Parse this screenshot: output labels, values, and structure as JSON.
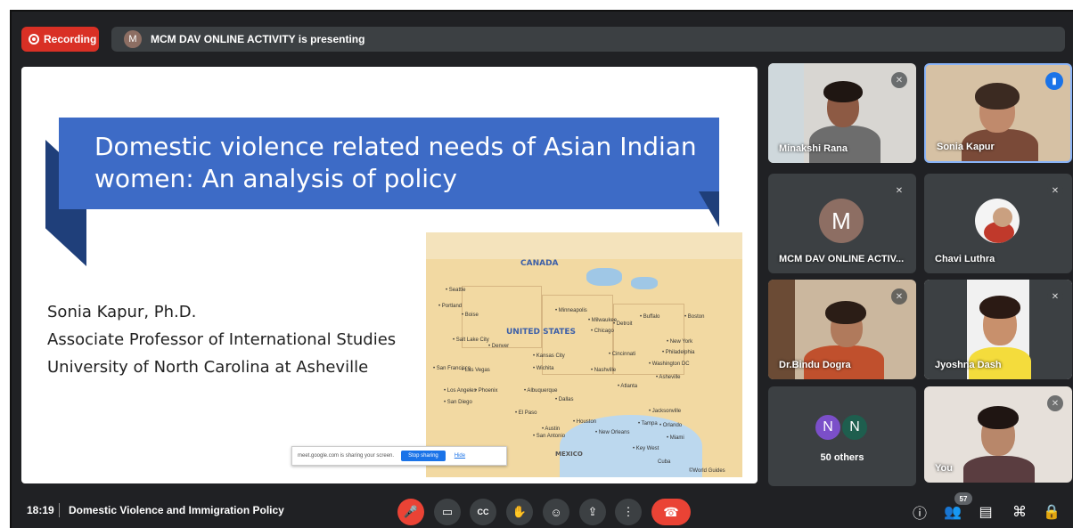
{
  "recording": {
    "label": "Recording"
  },
  "presenter_bar": {
    "avatar": "M",
    "text": "MCM DAV ONLINE ACTIVITY is presenting"
  },
  "slide": {
    "title": "Domestic violence related needs of Asian Indian women: An analysis of policy",
    "author_lines": [
      "Sonia Kapur, Ph.D.",
      "Associate Professor of International Studies",
      "University of North Carolina at Asheville"
    ],
    "map_labels": {
      "canada": "CANADA",
      "usa": "UNITED STATES",
      "mexico": "MEXICO",
      "cuba": "Cuba",
      "credit": "©World Guides"
    },
    "cities": [
      "Seattle",
      "Portland",
      "Boise",
      "Minneapolis",
      "Milwaukee",
      "Detroit",
      "Buffalo",
      "Boston",
      "Salt Lake City",
      "Denver",
      "Chicago",
      "Kansas City",
      "Cincinnati",
      "New York",
      "Philadelphia",
      "San Francisco",
      "Las Vegas",
      "Wichita",
      "Nashville",
      "Washington DC",
      "Los Angeles",
      "Phoenix",
      "Albuquerque",
      "Asheville",
      "Atlanta",
      "San Diego",
      "Dallas",
      "El Paso",
      "Houston",
      "Austin",
      "San Antonio",
      "New Orleans",
      "Jacksonville",
      "Tampa",
      "Orlando",
      "Miami",
      "Key West"
    ],
    "share_bar": {
      "text": "meet.google.com is sharing your screen.",
      "stop": "Stop sharing",
      "hide": "Hide"
    }
  },
  "participants": [
    {
      "name": "Minakshi Rana",
      "muted": true
    },
    {
      "name": "Sonia Kapur",
      "speaking": true
    },
    {
      "name": "MCM DAV ONLINE ACTIV...",
      "avatar": "M",
      "muted": true
    },
    {
      "name": "Chavi Luthra",
      "muted": true
    },
    {
      "name": "Dr.Bindu Dogra",
      "muted": true
    },
    {
      "name": "Jyoshna Dash",
      "muted": true
    },
    {
      "name": "You",
      "muted": true
    }
  ],
  "others": {
    "avatars": [
      "N",
      "N"
    ],
    "label": "50 others"
  },
  "bottom_bar": {
    "time": "18:19",
    "meeting_title": "Domestic Violence and Immigration Policy",
    "controls": [
      "mic-off",
      "camera",
      "captions",
      "raise-hand",
      "emoji",
      "present",
      "more",
      "end-call"
    ],
    "participant_count": "57"
  },
  "colors": {
    "background": "#202124",
    "tile": "#3c4043",
    "recording": "#d93025",
    "end_call": "#ea4335",
    "banner": "#3d6bc6"
  }
}
